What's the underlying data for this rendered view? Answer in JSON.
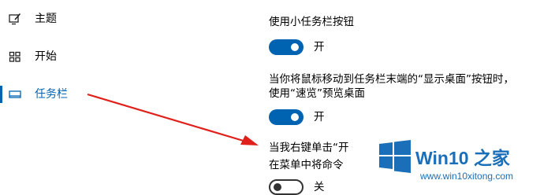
{
  "sidebar": {
    "items": [
      {
        "icon": "pen-monitor-icon",
        "label": "主题",
        "selected": false
      },
      {
        "icon": "start-grid-icon",
        "label": "开始",
        "selected": false
      },
      {
        "icon": "taskbar-icon",
        "label": "任务栏",
        "selected": true
      }
    ]
  },
  "settings": {
    "small_buttons": {
      "title": "使用小任务栏按钮",
      "state": "开"
    },
    "peek": {
      "title_line1": "当你将鼠标移动到任务栏末端的“显示桌面”按钮时，",
      "title_line2": "使用“速览”预览桌面",
      "state": "开"
    },
    "powershell": {
      "title_line1": "当我右键单击“开",
      "title_line2": "在菜单中将命令",
      "state": "关"
    }
  },
  "watermark": {
    "brand": "Win10 之家",
    "url": "www.win10xitong.com"
  },
  "colors": {
    "accent": "#0063b1",
    "arrow": "#e0201a",
    "logo": "#1b6fb8"
  }
}
